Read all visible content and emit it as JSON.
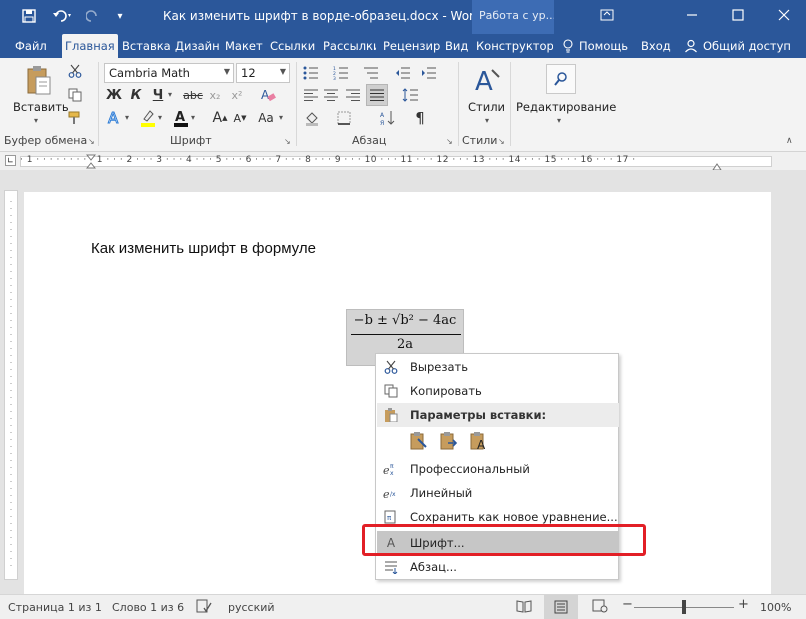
{
  "titlebar": {
    "title": "Как изменить шрифт в ворде-образец.docx - Word",
    "context_tab": "Работа с ур...",
    "icons": {
      "save": "save-icon",
      "undo": "undo-icon",
      "redo": "redo-icon",
      "customize": "customize-qat-icon",
      "ribbon_options": "ribbon-display-options-icon",
      "minimize": "minimize-icon",
      "maximize": "maximize-icon",
      "close": "close-icon"
    }
  },
  "tabs": [
    {
      "label": "Файл",
      "active": false
    },
    {
      "label": "Главная",
      "active": true
    },
    {
      "label": "Вставка",
      "active": false
    },
    {
      "label": "Дизайн",
      "active": false
    },
    {
      "label": "Макет",
      "active": false
    },
    {
      "label": "Ссылки",
      "active": false
    },
    {
      "label": "Рассылки",
      "active": false
    },
    {
      "label": "Рецензир",
      "active": false
    },
    {
      "label": "Вид",
      "active": false
    },
    {
      "label": "Конструктор",
      "active": false
    },
    {
      "label": "Помощь",
      "active": false
    },
    {
      "label": "Вход",
      "active": false
    },
    {
      "label": "Общий доступ",
      "active": false
    }
  ],
  "ribbon": {
    "clipboard": {
      "paste_label": "Вставить",
      "group_label": "Буфер обмена"
    },
    "font": {
      "font_name": "Cambria Math",
      "font_size": "12",
      "group_label": "Шрифт",
      "bold": "Ж",
      "italic": "К",
      "underline": "Ч",
      "strike": "abc",
      "subscript": "x₂",
      "superscript": "x²",
      "grow": "A",
      "shrink": "A",
      "case": "Aa"
    },
    "paragraph": {
      "group_label": "Абзац"
    },
    "styles": {
      "label": "Стили",
      "group_label": "Стили"
    },
    "editing": {
      "label": "Редактирование"
    }
  },
  "ruler": {
    "numbers": "· 1 · · · · · · · · · 1 · · · 2 · · · 3 · · · 4 · · · 5 · · · 6 · · · 7 · · · 8 · · · 9 · · · 10 · · · 11 · · · 12 · · · 13 · · · 14 · · · 15 · · · 16 · · · 17 ·"
  },
  "document": {
    "heading": "Как изменить шрифт в формуле",
    "equation": {
      "numerator": "−b ± √b² − 4ac",
      "denominator": "2a"
    }
  },
  "context_menu": {
    "items": [
      {
        "label": "Вырезать",
        "icon": "scissors-icon"
      },
      {
        "label": "Копировать",
        "icon": "copy-icon"
      },
      {
        "label": "Параметры вставки:",
        "icon": "paste-icon",
        "header": true
      },
      {
        "label": "Профессиональный",
        "icon": "equation-professional-icon"
      },
      {
        "label": "Линейный",
        "icon": "equation-linear-icon"
      },
      {
        "label": "Сохранить как новое уравнение...",
        "icon": "save-equation-icon"
      },
      {
        "label": "Шрифт...",
        "icon": "font-icon",
        "selected": true
      },
      {
        "label": "Абзац...",
        "icon": "paragraph-icon"
      }
    ],
    "paste_options": [
      {
        "name": "paste-keep-source-icon"
      },
      {
        "name": "paste-merge-icon"
      },
      {
        "name": "paste-text-only-icon"
      }
    ]
  },
  "statusbar": {
    "page": "Страница 1 из 1",
    "words": "Слово 1 из 6",
    "language": "русский",
    "zoom": "100%"
  },
  "colors": {
    "accent": "#2b579a",
    "highlight": "#e21f26"
  }
}
